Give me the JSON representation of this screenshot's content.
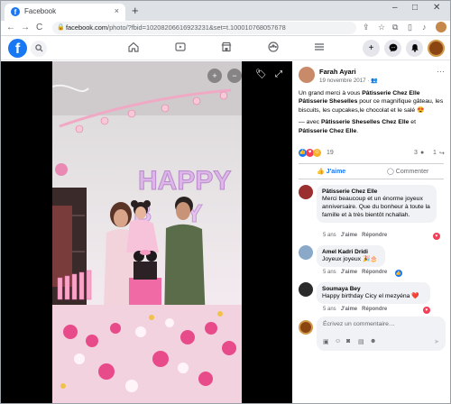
{
  "browser": {
    "tab_title": "Facebook",
    "tab_close": "×",
    "new_tab": "+",
    "win_min": "–",
    "win_max": "□",
    "win_close": "✕",
    "back": "←",
    "forward": "→",
    "reload": "C",
    "lock": "🔒",
    "url_host": "facebook.com",
    "url_path": "/photo/?fbid=10208206616923231&set=t.100010768057678"
  },
  "fb_nav": {
    "logo": "f",
    "search_icon": "🔍",
    "plus": "+",
    "messenger": "✉",
    "bell": "🔔"
  },
  "photo": {
    "zoom_in": "+",
    "zoom_out": "−",
    "tag_icon": "🏷",
    "fullscreen_icon": "⤢",
    "balloon_letters": "HAPPY"
  },
  "post": {
    "author": "Farah Ayari",
    "date": "19 novembre 2017 · 👥",
    "more": "···",
    "text_1": "Un grand merci à vous ",
    "text_1b": "Pâtisserie Chez Elle Pâtisserie Sheselles",
    "text_1c": " pour ce magnifique gâteau, les biscuits, les cupcakes,le chocolat et le salé 😍",
    "text_2": "— avec ",
    "text_2b": "Pâtisserie Sheselles Chez Elle",
    "text_2c": " et ",
    "text_2d": "Pâtisserie Chez Elle",
    "text_2e": ".",
    "reaction_count": "19",
    "comments_count": "3",
    "shares_count": "1",
    "like_label": "J'aime",
    "comment_label": "Commenter"
  },
  "comments": [
    {
      "name": "Pâtisserie Chez Elle",
      "text": "Merci beaucoup et un énorme joyeux anniversaire. Que du bonheur à toute la famille et à très bientôt nchallah.",
      "age": "5 ans",
      "like": "J'aime",
      "reply": "Répondre"
    },
    {
      "name": "Amel Kadri Dridi",
      "text": "Joyeux joyeux 🎉🎂",
      "age": "5 ans",
      "like": "J'aime",
      "reply": "Répondre"
    },
    {
      "name": "Soumaya Bey",
      "text": "Happy birthday Cicy el mezyéna ❤️",
      "age": "5 ans",
      "like": "J'aime",
      "reply": "Répondre"
    }
  ],
  "composer": {
    "placeholder": "Écrivez un commentaire…",
    "send": "➤"
  }
}
